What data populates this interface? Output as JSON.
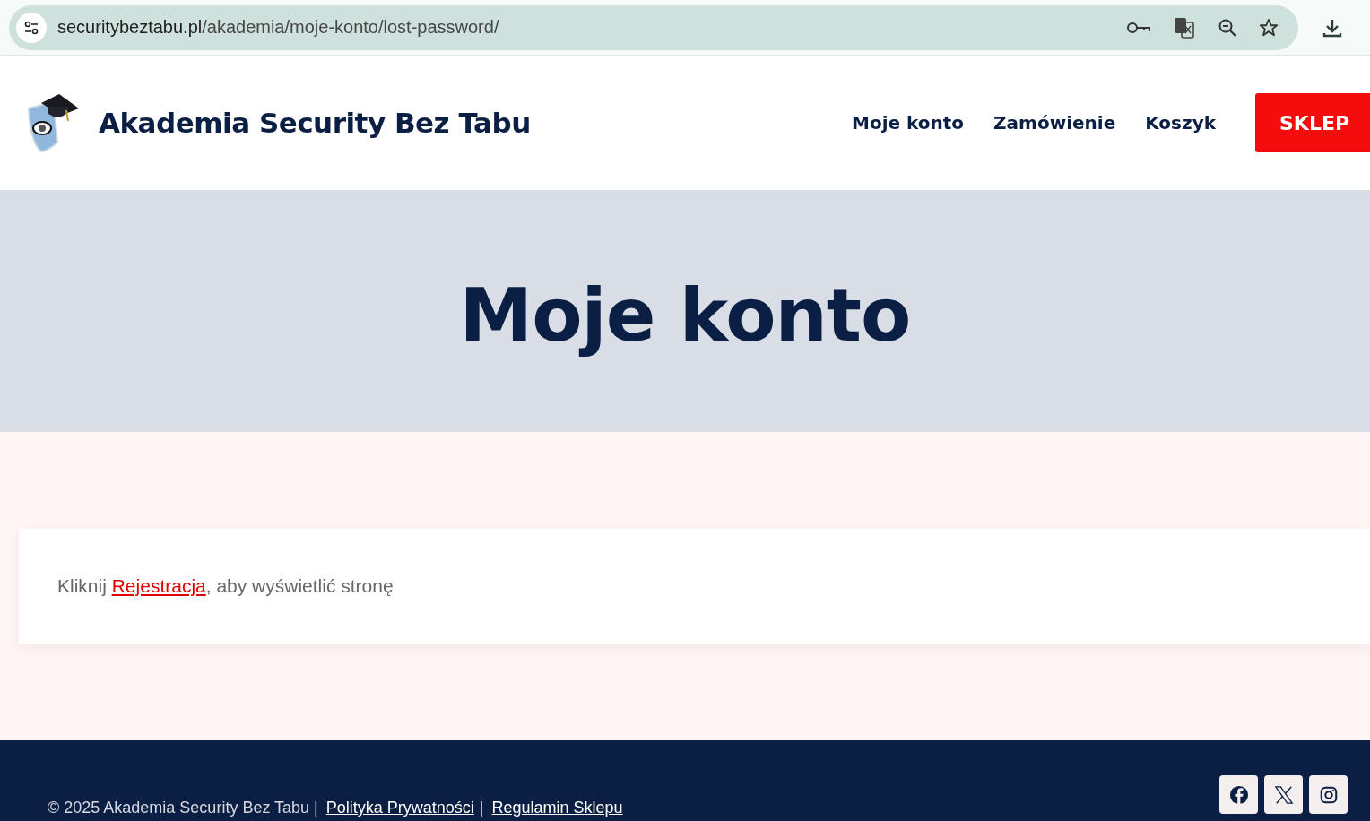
{
  "browser": {
    "url_host": "securitybeztabu.pl",
    "url_path": "/akademia/moje-konto/lost-password/"
  },
  "header": {
    "site_title": "Akademia Security Bez Tabu",
    "nav": [
      "Moje konto",
      "Zamówienie",
      "Koszyk"
    ],
    "shop_button": "SKLEP"
  },
  "hero": {
    "title": "Moje konto"
  },
  "notice": {
    "before": "Kliknij ",
    "link": "Rejestracja",
    "after": ", aby wyświetlić stronę"
  },
  "footer": {
    "copyright": "© 2025 Akademia Security Bez Tabu |",
    "links": [
      "Polityka Prywatności",
      "Regulamin Sklepu"
    ],
    "separator": "|",
    "social": [
      {
        "kind": "facebook"
      },
      {
        "kind": "x"
      },
      {
        "kind": "instagram"
      }
    ]
  }
}
